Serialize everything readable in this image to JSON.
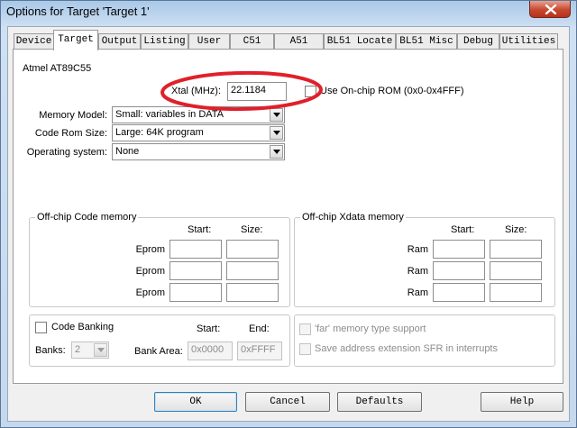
{
  "window": {
    "title": "Options for Target 'Target 1'"
  },
  "tabs": [
    {
      "label": "Device"
    },
    {
      "label": "Target"
    },
    {
      "label": "Output"
    },
    {
      "label": "Listing"
    },
    {
      "label": "User"
    },
    {
      "label": "C51"
    },
    {
      "label": "A51"
    },
    {
      "label": "BL51 Locate"
    },
    {
      "label": "BL51 Misc"
    },
    {
      "label": "Debug"
    },
    {
      "label": "Utilities"
    }
  ],
  "active_tab": "Target",
  "device_name": "Atmel AT89C55",
  "xtal": {
    "label": "Xtal (MHz):",
    "value": "22.1184"
  },
  "onchip_rom": {
    "label": "Use On-chip ROM (0x0-0x4FFF)",
    "checked": false
  },
  "memory_model": {
    "label": "Memory Model:",
    "value": "Small: variables in DATA"
  },
  "code_rom_size": {
    "label": "Code Rom Size:",
    "value": "Large: 64K program"
  },
  "operating_system": {
    "label": "Operating system:",
    "value": "None"
  },
  "offchip_code": {
    "title": "Off-chip Code memory",
    "start_header": "Start:",
    "size_header": "Size:",
    "rows": [
      {
        "label": "Eprom"
      },
      {
        "label": "Eprom"
      },
      {
        "label": "Eprom"
      }
    ]
  },
  "offchip_xdata": {
    "title": "Off-chip Xdata memory",
    "start_header": "Start:",
    "size_header": "Size:",
    "rows": [
      {
        "label": "Ram"
      },
      {
        "label": "Ram"
      },
      {
        "label": "Ram"
      }
    ]
  },
  "code_banking": {
    "label": "Code Banking",
    "checked": false,
    "start_header": "Start:",
    "end_header": "End:",
    "banks_label": "Banks:",
    "banks_value": "2",
    "bank_area_label": "Bank Area:",
    "bank_area_start": "0x0000",
    "bank_area_end": "0xFFFF"
  },
  "far_memory": {
    "label": "'far' memory type support",
    "checked": false
  },
  "save_sfr": {
    "label": "Save address extension SFR in interrupts",
    "checked": false
  },
  "buttons": {
    "ok": "OK",
    "cancel": "Cancel",
    "defaults": "Defaults",
    "help": "Help"
  },
  "colors": {
    "highlight_ellipse": "#e0202a",
    "close_button": "#c7472f"
  },
  "icons": {
    "close": "close-icon",
    "dropdown": "chevron-down-icon"
  }
}
